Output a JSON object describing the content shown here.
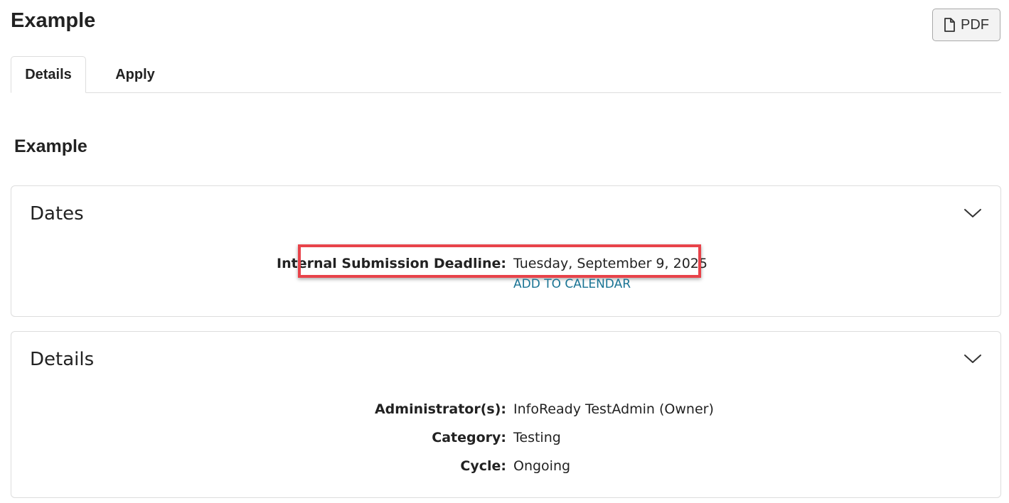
{
  "page": {
    "title": "Example"
  },
  "toolbar": {
    "pdf_label": "PDF",
    "pdf_icon": "file-icon"
  },
  "tabs": [
    {
      "label": "Details",
      "active": true
    },
    {
      "label": "Apply",
      "active": false
    }
  ],
  "section": {
    "title": "Example"
  },
  "dates_panel": {
    "title": "Dates",
    "toggle_icon": "chevron-down-icon",
    "rows": [
      {
        "label": "Internal Submission Deadline:",
        "value": "Tuesday, September 9, 2025"
      }
    ],
    "add_to_calendar": "ADD TO CALENDAR"
  },
  "details_panel": {
    "title": "Details",
    "toggle_icon": "chevron-down-icon",
    "rows": [
      {
        "label": "Administrator(s):",
        "value": "InfoReady TestAdmin (Owner)"
      },
      {
        "label": "Category:",
        "value": "Testing"
      },
      {
        "label": "Cycle:",
        "value": "Ongoing"
      }
    ]
  },
  "colors": {
    "link": "#1a7494",
    "highlight": "#e8434a",
    "border": "#dddddd"
  }
}
